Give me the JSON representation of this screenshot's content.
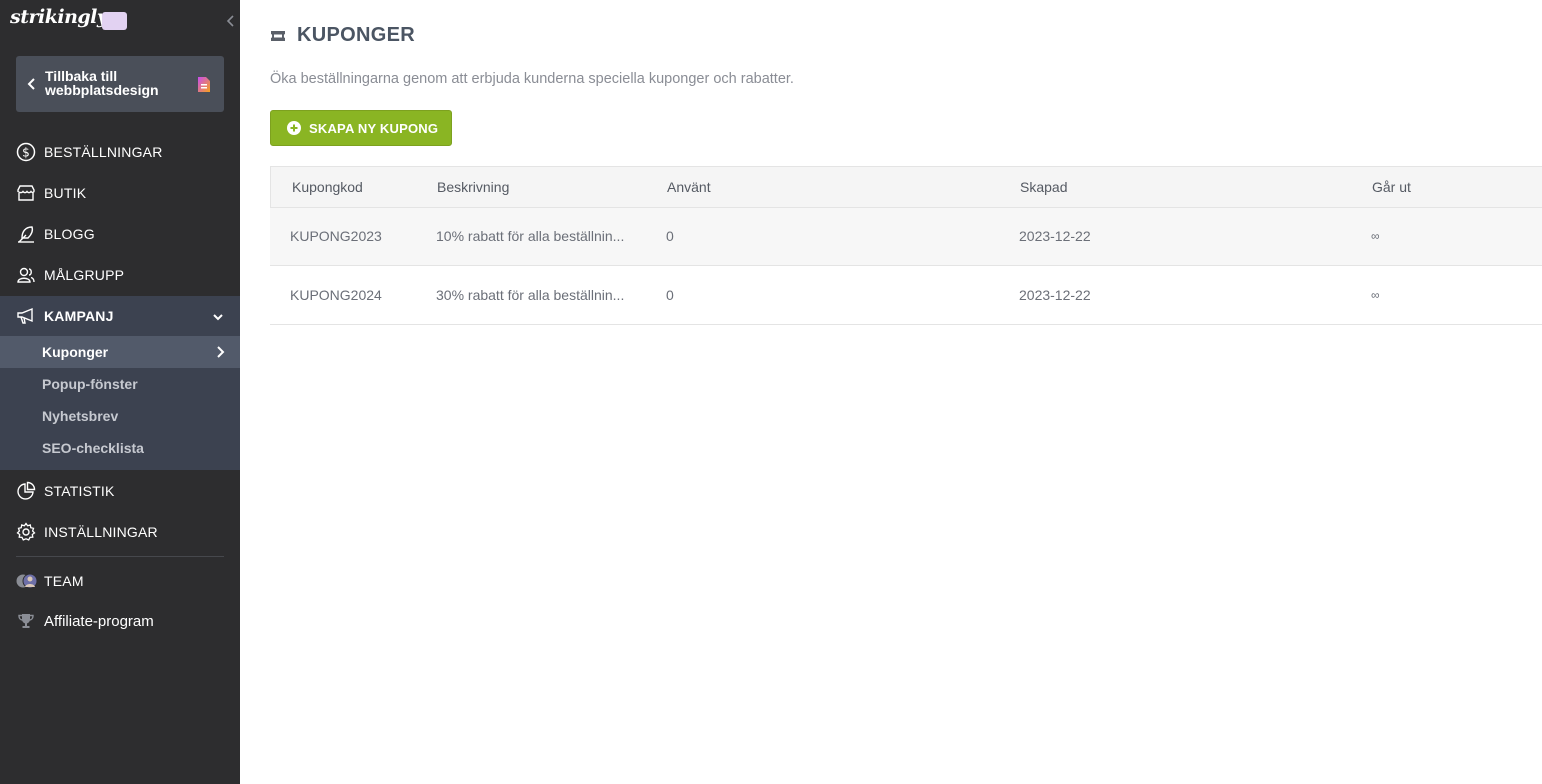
{
  "brand": {
    "logo_text": "strikingly"
  },
  "sidebar": {
    "back_label": "Tillbaka till webbplatsdesign",
    "nav": [
      {
        "label": "BESTÄLLNINGAR",
        "icon": "dollar-circle-icon"
      },
      {
        "label": "BUTIK",
        "icon": "store-icon"
      },
      {
        "label": "BLOGG",
        "icon": "feather-icon"
      },
      {
        "label": "MÅLGRUPP",
        "icon": "users-icon"
      },
      {
        "label": "KAMPANJ",
        "icon": "megaphone-icon"
      },
      {
        "label": "STATISTIK",
        "icon": "pie-chart-icon"
      },
      {
        "label": "INSTÄLLNINGAR",
        "icon": "gear-icon"
      },
      {
        "label": "TEAM",
        "icon": "team-avatars-icon"
      },
      {
        "label": "Affiliate-program",
        "icon": "trophy-icon"
      }
    ],
    "subnav": [
      {
        "label": "Kuponger",
        "active": true
      },
      {
        "label": "Popup-fönster"
      },
      {
        "label": "Nyhetsbrev"
      },
      {
        "label": "SEO-checklista"
      }
    ]
  },
  "main": {
    "title": "KUPONGER",
    "description": "Öka beställningarna genom att erbjuda kunderna speciella kuponger och rabatter.",
    "create_button": "SKAPA NY KUPONG",
    "table": {
      "headers": [
        "Kupongkod",
        "Beskrivning",
        "Använt",
        "Skapad",
        "Går ut"
      ],
      "rows": [
        {
          "code": "KUPONG2023",
          "description": "10% rabatt för alla beställnin...",
          "used": "0",
          "created": "2023-12-22",
          "expires": "∞"
        },
        {
          "code": "KUPONG2024",
          "description": "30% rabatt för alla beställnin...",
          "used": "0",
          "created": "2023-12-22",
          "expires": "∞"
        }
      ]
    }
  },
  "colors": {
    "sidebar_bg": "#2d2d2f",
    "sidebar_active_bg": "#3c4250",
    "sidebar_selected_bg": "#525a6a",
    "accent_green": "#8ab523",
    "title_text": "#4b5563"
  }
}
